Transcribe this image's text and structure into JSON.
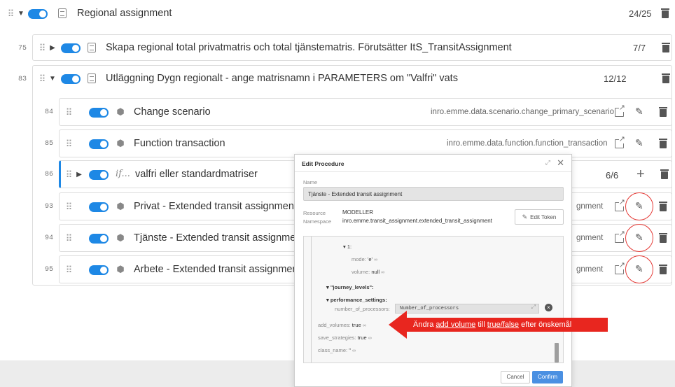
{
  "top_row": {
    "title": "Regional assignment",
    "count": "24/25"
  },
  "rows": [
    {
      "num": "75",
      "title": "Skapa regional total privatmatris och total tjänstematris. Förutsätter ItS_TransitAssignment",
      "count": "7/7"
    },
    {
      "num": "83",
      "title": "Utläggning Dygn regionalt - ange matrisnamn i PARAMETERS om \"Valfri\" vats",
      "count": "12/12"
    },
    {
      "num": "84",
      "title": "Change scenario",
      "namespace": "inro.emme.data.scenario.change_primary_scenario"
    },
    {
      "num": "85",
      "title": "Function transaction",
      "namespace": "inro.emme.data.function.function_transaction"
    },
    {
      "num": "86",
      "title": "valfri eller standardmatriser",
      "count": "6/6",
      "if_label": "if..."
    },
    {
      "num": "93",
      "title": "Privat - Extended transit assignment",
      "namespace_tail": "gnment"
    },
    {
      "num": "94",
      "title": "Tjänste - Extended transit assignment",
      "namespace_tail": "gnment"
    },
    {
      "num": "95",
      "title": "Arbete - Extended transit assignment",
      "namespace_tail": "gnment"
    }
  ],
  "dialog": {
    "title": "Edit Procedure",
    "name_label": "Name",
    "name_value": "Tjänste - Extended transit assignment",
    "resource_label": "Resource",
    "resource_value": "MODELLER",
    "namespace_label": "Namespace",
    "namespace_value": "inro.emme.transit_assignment.extended_transit_assignment",
    "edit_token": "Edit Token",
    "tree": {
      "item1": "▾ 1:",
      "mode_key": "mode:",
      "mode_val": "'e'",
      "volume_key": "volume:",
      "volume_val": "null",
      "journey_levels": "▾ \"journey_levels\":",
      "performance_settings": "▾ performance_settings:",
      "processors_key": "number_of_processors:",
      "processors_val": "Number_of_processors",
      "add_volumes_key": "add_volumes:",
      "add_volumes_val": "true",
      "save_strategies_key": "save_strategies:",
      "save_strategies_val": "true",
      "class_name_key": "class_name:",
      "class_name_val": "\""
    },
    "cancel": "Cancel",
    "confirm": "Confirm"
  },
  "annotation": {
    "prefix": "Ändra ",
    "u1": "add volume",
    "mid": " till ",
    "u2": "true/false",
    "suffix": " efter önskemål"
  },
  "colors": {
    "accent": "#1e88e5",
    "annotation": "#e8261f",
    "confirm": "#4a90e2"
  }
}
